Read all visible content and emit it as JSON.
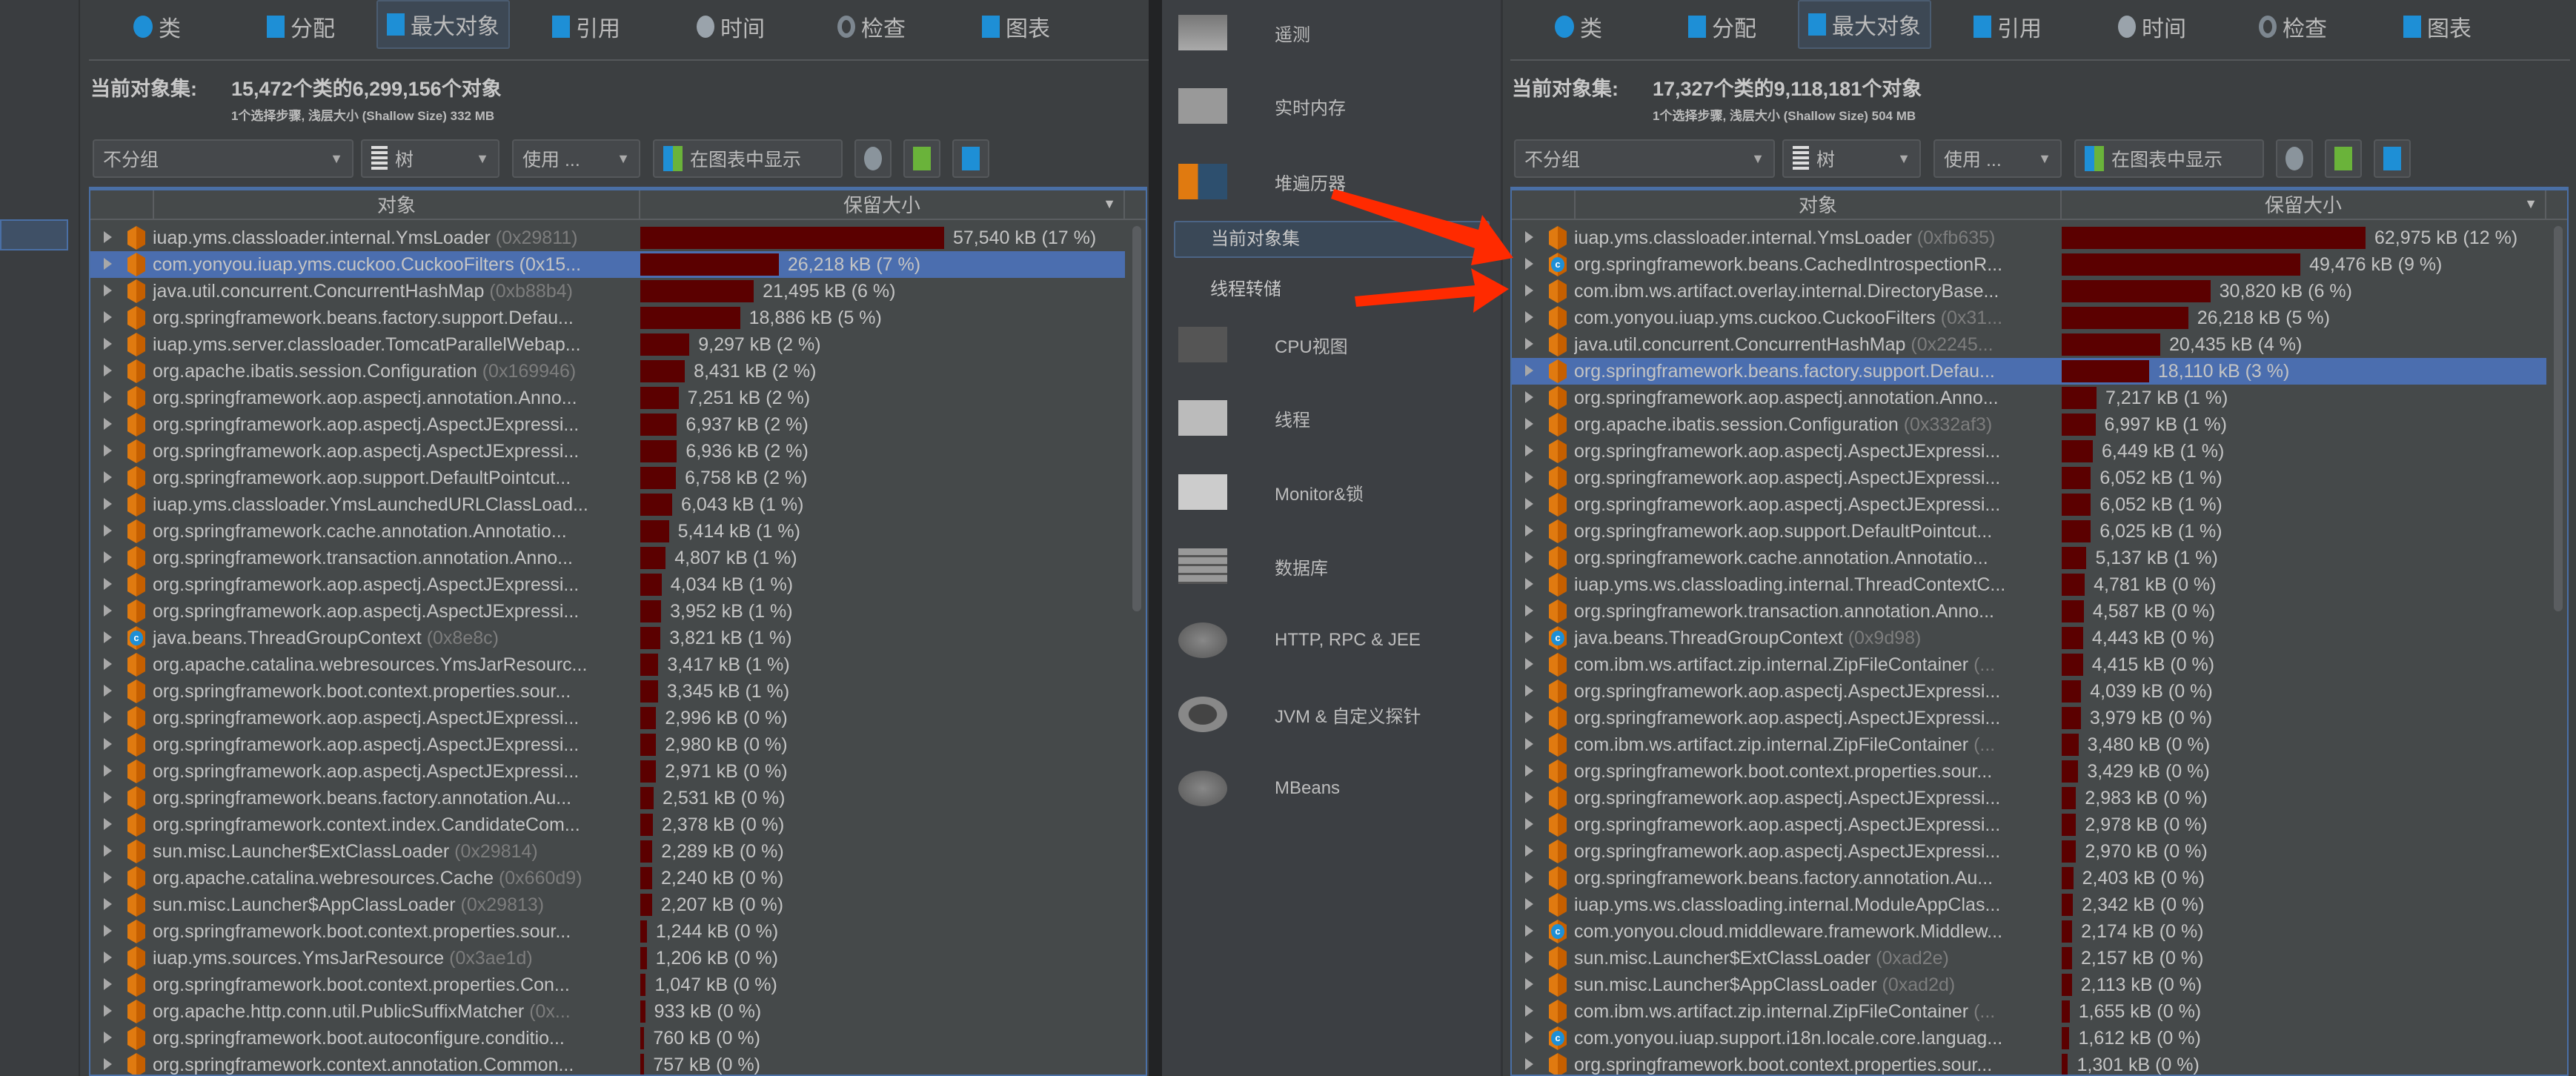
{
  "colors": {
    "bar": "#5b0000",
    "selection": "#4b6eaf",
    "accent_arrow": "#ff2a00",
    "object_icon": "#e07a10",
    "class_icon": "#1e8fd6"
  },
  "tabs": [
    {
      "label": "类",
      "icon": "class-icon"
    },
    {
      "label": "分配",
      "icon": "allocation-icon"
    },
    {
      "label": "最大对象",
      "icon": "biggest-objects-icon",
      "active": true
    },
    {
      "label": "引用",
      "icon": "references-icon"
    },
    {
      "label": "时间",
      "icon": "time-icon"
    },
    {
      "label": "检查",
      "icon": "inspections-icon"
    },
    {
      "label": "图表",
      "icon": "graph-icon"
    }
  ],
  "toolbar": {
    "grouping": "不分组",
    "view": "树",
    "use": "使用 ...",
    "show_in_graph": "在图表中显示"
  },
  "table_headers": {
    "object": "对象",
    "retained": "保留大小"
  },
  "left": {
    "heading_label": "当前对象集:",
    "heading_value": "15,472个类的6,299,156个对象",
    "subline": "1个选择步骤, 浅层大小 (Shallow Size) 332 MB",
    "rows": [
      {
        "name": "iuap.yms.classloader.internal.YmsLoader",
        "id": "(0x29811)",
        "kb": 57540,
        "size": "57,540 kB (17 %)",
        "icon": "object"
      },
      {
        "name": "com.yonyou.iuap.yms.cuckoo.CuckooFilters (0x15...",
        "id": "",
        "kb": 26218,
        "size": "26,218 kB (7 %)",
        "icon": "object",
        "selected": true
      },
      {
        "name": "java.util.concurrent.ConcurrentHashMap",
        "id": "(0xb88b4)",
        "kb": 21495,
        "size": "21,495 kB (6 %)",
        "icon": "object"
      },
      {
        "name": "org.springframework.beans.factory.support.Defau...",
        "id": "",
        "kb": 18886,
        "size": "18,886 kB (5 %)",
        "icon": "object"
      },
      {
        "name": "iuap.yms.server.classloader.TomcatParallelWebap...",
        "id": "",
        "kb": 9297,
        "size": "9,297 kB (2 %)",
        "icon": "object"
      },
      {
        "name": "org.apache.ibatis.session.Configuration",
        "id": "(0x169946)",
        "kb": 8431,
        "size": "8,431 kB (2 %)",
        "icon": "object"
      },
      {
        "name": "org.springframework.aop.aspectj.annotation.Anno...",
        "id": "",
        "kb": 7251,
        "size": "7,251 kB (2 %)",
        "icon": "object"
      },
      {
        "name": "org.springframework.aop.aspectj.AspectJExpressi...",
        "id": "",
        "kb": 6937,
        "size": "6,937 kB (2 %)",
        "icon": "object"
      },
      {
        "name": "org.springframework.aop.aspectj.AspectJExpressi...",
        "id": "",
        "kb": 6936,
        "size": "6,936 kB (2 %)",
        "icon": "object"
      },
      {
        "name": "org.springframework.aop.support.DefaultPointcut...",
        "id": "",
        "kb": 6758,
        "size": "6,758 kB (2 %)",
        "icon": "object"
      },
      {
        "name": "iuap.yms.classloader.YmsLaunchedURLClassLoad...",
        "id": "",
        "kb": 6043,
        "size": "6,043 kB (1 %)",
        "icon": "object"
      },
      {
        "name": "org.springframework.cache.annotation.Annotatio...",
        "id": "",
        "kb": 5414,
        "size": "5,414 kB (1 %)",
        "icon": "object"
      },
      {
        "name": "org.springframework.transaction.annotation.Anno...",
        "id": "",
        "kb": 4807,
        "size": "4,807 kB (1 %)",
        "icon": "object"
      },
      {
        "name": "org.springframework.aop.aspectj.AspectJExpressi...",
        "id": "",
        "kb": 4034,
        "size": "4,034 kB (1 %)",
        "icon": "object"
      },
      {
        "name": "org.springframework.aop.aspectj.AspectJExpressi...",
        "id": "",
        "kb": 3952,
        "size": "3,952 kB (1 %)",
        "icon": "object"
      },
      {
        "name": "java.beans.ThreadGroupContext",
        "id": "(0x8e8c)",
        "kb": 3821,
        "size": "3,821 kB (1 %)",
        "icon": "class"
      },
      {
        "name": "org.apache.catalina.webresources.YmsJarResourc...",
        "id": "",
        "kb": 3417,
        "size": "3,417 kB (1 %)",
        "icon": "object"
      },
      {
        "name": "org.springframework.boot.context.properties.sour...",
        "id": "",
        "kb": 3345,
        "size": "3,345 kB (1 %)",
        "icon": "object"
      },
      {
        "name": "org.springframework.aop.aspectj.AspectJExpressi...",
        "id": "",
        "kb": 2996,
        "size": "2,996 kB (0 %)",
        "icon": "object"
      },
      {
        "name": "org.springframework.aop.aspectj.AspectJExpressi...",
        "id": "",
        "kb": 2980,
        "size": "2,980 kB (0 %)",
        "icon": "object"
      },
      {
        "name": "org.springframework.aop.aspectj.AspectJExpressi...",
        "id": "",
        "kb": 2971,
        "size": "2,971 kB (0 %)",
        "icon": "object"
      },
      {
        "name": "org.springframework.beans.factory.annotation.Au...",
        "id": "",
        "kb": 2531,
        "size": "2,531 kB (0 %)",
        "icon": "object"
      },
      {
        "name": "org.springframework.context.index.CandidateCom...",
        "id": "",
        "kb": 2378,
        "size": "2,378 kB (0 %)",
        "icon": "object"
      },
      {
        "name": "sun.misc.Launcher$ExtClassLoader",
        "id": "(0x29814)",
        "kb": 2289,
        "size": "2,289 kB (0 %)",
        "icon": "object"
      },
      {
        "name": "org.apache.catalina.webresources.Cache",
        "id": "(0x660d9)",
        "kb": 2240,
        "size": "2,240 kB (0 %)",
        "icon": "object"
      },
      {
        "name": "sun.misc.Launcher$AppClassLoader",
        "id": "(0x29813)",
        "kb": 2207,
        "size": "2,207 kB (0 %)",
        "icon": "object"
      },
      {
        "name": "org.springframework.boot.context.properties.sour...",
        "id": "",
        "kb": 1244,
        "size": "1,244 kB (0 %)",
        "icon": "object"
      },
      {
        "name": "iuap.yms.sources.YmsJarResource",
        "id": "(0x3ae1d)",
        "kb": 1206,
        "size": "1,206 kB (0 %)",
        "icon": "object"
      },
      {
        "name": "org.springframework.boot.context.properties.Con...",
        "id": "",
        "kb": 1047,
        "size": "1,047 kB (0 %)",
        "icon": "object"
      },
      {
        "name": "org.apache.http.conn.util.PublicSuffixMatcher",
        "id": "(0x...",
        "kb": 933,
        "size": "933 kB (0 %)",
        "icon": "object"
      },
      {
        "name": "org.springframework.boot.autoconfigure.conditio...",
        "id": "",
        "kb": 760,
        "size": "760 kB (0 %)",
        "icon": "object"
      },
      {
        "name": "org.springframework.context.annotation.Common...",
        "id": "",
        "kb": 757,
        "size": "757 kB (0 %)",
        "icon": "object"
      }
    ]
  },
  "right": {
    "heading_label": "当前对象集:",
    "heading_value": "17,327个类的9,118,181个对象",
    "subline": "1个选择步骤, 浅层大小 (Shallow Size) 504 MB",
    "rows": [
      {
        "name": "iuap.yms.classloader.internal.YmsLoader",
        "id": "(0xfb635)",
        "kb": 62975,
        "size": "62,975 kB (12 %)",
        "icon": "object"
      },
      {
        "name": "org.springframework.beans.CachedIntrospectionR...",
        "id": "",
        "kb": 49476,
        "size": "49,476 kB (9 %)",
        "icon": "class"
      },
      {
        "name": "com.ibm.ws.artifact.overlay.internal.DirectoryBase...",
        "id": "",
        "kb": 30820,
        "size": "30,820 kB (6 %)",
        "icon": "object"
      },
      {
        "name": "com.yonyou.iuap.yms.cuckoo.CuckooFilters",
        "id": "(0x31...",
        "kb": 26218,
        "size": "26,218 kB (5 %)",
        "icon": "object"
      },
      {
        "name": "java.util.concurrent.ConcurrentHashMap",
        "id": "(0x2245...",
        "kb": 20435,
        "size": "20,435 kB (4 %)",
        "icon": "object"
      },
      {
        "name": "org.springframework.beans.factory.support.Defau...",
        "id": "",
        "kb": 18110,
        "size": "18,110 kB (3 %)",
        "icon": "object",
        "selected": true
      },
      {
        "name": "org.springframework.aop.aspectj.annotation.Anno...",
        "id": "",
        "kb": 7217,
        "size": "7,217 kB (1 %)",
        "icon": "object"
      },
      {
        "name": "org.apache.ibatis.session.Configuration",
        "id": "(0x332af3)",
        "kb": 6997,
        "size": "6,997 kB (1 %)",
        "icon": "object"
      },
      {
        "name": "org.springframework.aop.aspectj.AspectJExpressi...",
        "id": "",
        "kb": 6449,
        "size": "6,449 kB (1 %)",
        "icon": "object"
      },
      {
        "name": "org.springframework.aop.aspectj.AspectJExpressi...",
        "id": "",
        "kb": 6052,
        "size": "6,052 kB (1 %)",
        "icon": "object"
      },
      {
        "name": "org.springframework.aop.aspectj.AspectJExpressi...",
        "id": "",
        "kb": 6052,
        "size": "6,052 kB (1 %)",
        "icon": "object"
      },
      {
        "name": "org.springframework.aop.support.DefaultPointcut...",
        "id": "",
        "kb": 6025,
        "size": "6,025 kB (1 %)",
        "icon": "object"
      },
      {
        "name": "org.springframework.cache.annotation.Annotatio...",
        "id": "",
        "kb": 5137,
        "size": "5,137 kB (1 %)",
        "icon": "object"
      },
      {
        "name": "iuap.yms.ws.classloading.internal.ThreadContextC...",
        "id": "",
        "kb": 4781,
        "size": "4,781 kB (0 %)",
        "icon": "object"
      },
      {
        "name": "org.springframework.transaction.annotation.Anno...",
        "id": "",
        "kb": 4587,
        "size": "4,587 kB (0 %)",
        "icon": "object"
      },
      {
        "name": "java.beans.ThreadGroupContext",
        "id": "(0x9d98)",
        "kb": 4443,
        "size": "4,443 kB (0 %)",
        "icon": "class"
      },
      {
        "name": "com.ibm.ws.artifact.zip.internal.ZipFileContainer",
        "id": "(...",
        "kb": 4415,
        "size": "4,415 kB (0 %)",
        "icon": "object"
      },
      {
        "name": "org.springframework.aop.aspectj.AspectJExpressi...",
        "id": "",
        "kb": 4039,
        "size": "4,039 kB (0 %)",
        "icon": "object"
      },
      {
        "name": "org.springframework.aop.aspectj.AspectJExpressi...",
        "id": "",
        "kb": 3979,
        "size": "3,979 kB (0 %)",
        "icon": "object"
      },
      {
        "name": "com.ibm.ws.artifact.zip.internal.ZipFileContainer",
        "id": "(...",
        "kb": 3480,
        "size": "3,480 kB (0 %)",
        "icon": "object"
      },
      {
        "name": "org.springframework.boot.context.properties.sour...",
        "id": "",
        "kb": 3429,
        "size": "3,429 kB (0 %)",
        "icon": "object"
      },
      {
        "name": "org.springframework.aop.aspectj.AspectJExpressi...",
        "id": "",
        "kb": 2983,
        "size": "2,983 kB (0 %)",
        "icon": "object"
      },
      {
        "name": "org.springframework.aop.aspectj.AspectJExpressi...",
        "id": "",
        "kb": 2978,
        "size": "2,978 kB (0 %)",
        "icon": "object"
      },
      {
        "name": "org.springframework.aop.aspectj.AspectJExpressi...",
        "id": "",
        "kb": 2970,
        "size": "2,970 kB (0 %)",
        "icon": "object"
      },
      {
        "name": "org.springframework.beans.factory.annotation.Au...",
        "id": "",
        "kb": 2403,
        "size": "2,403 kB (0 %)",
        "icon": "object"
      },
      {
        "name": "iuap.yms.ws.classloading.internal.ModuleAppClas...",
        "id": "",
        "kb": 2342,
        "size": "2,342 kB (0 %)",
        "icon": "object"
      },
      {
        "name": "com.yonyou.cloud.middleware.framework.Middlew...",
        "id": "",
        "kb": 2174,
        "size": "2,174 kB (0 %)",
        "icon": "class"
      },
      {
        "name": "sun.misc.Launcher$ExtClassLoader",
        "id": "(0xad2e)",
        "kb": 2157,
        "size": "2,157 kB (0 %)",
        "icon": "object"
      },
      {
        "name": "sun.misc.Launcher$AppClassLoader",
        "id": "(0xad2d)",
        "kb": 2113,
        "size": "2,113 kB (0 %)",
        "icon": "object"
      },
      {
        "name": "com.ibm.ws.artifact.zip.internal.ZipFileContainer",
        "id": "(...",
        "kb": 1655,
        "size": "1,655 kB (0 %)",
        "icon": "object"
      },
      {
        "name": "com.yonyou.iuap.support.i18n.locale.core.languag...",
        "id": "",
        "kb": 1612,
        "size": "1,612 kB (0 %)",
        "icon": "class"
      },
      {
        "name": "org.springframework.boot.context.properties.sour...",
        "id": "",
        "kb": 1301,
        "size": "1,301 kB (0 %)",
        "icon": "object"
      }
    ]
  },
  "nav": {
    "items": [
      {
        "label": "遥测",
        "icon": "telemetry-icon"
      },
      {
        "label": "实时内存",
        "icon": "live-memory-icon"
      },
      {
        "label": "堆遍历器",
        "icon": "heap-walker-icon"
      },
      {
        "label": "CPU视图",
        "icon": "cpu-icon"
      },
      {
        "label": "线程",
        "icon": "threads-icon"
      },
      {
        "label": "Monitor&锁",
        "icon": "lock-icon"
      },
      {
        "label": "数据库",
        "icon": "database-icon"
      },
      {
        "label": "HTTP, RPC & JEE",
        "icon": "globe-icon"
      },
      {
        "label": "JVM & 自定义探针",
        "icon": "gauge-icon"
      },
      {
        "label": "MBeans",
        "icon": "mbeans-icon"
      }
    ],
    "sub_items": [
      {
        "label": "当前对象集",
        "selected": true
      },
      {
        "label": "线程转储"
      }
    ]
  }
}
